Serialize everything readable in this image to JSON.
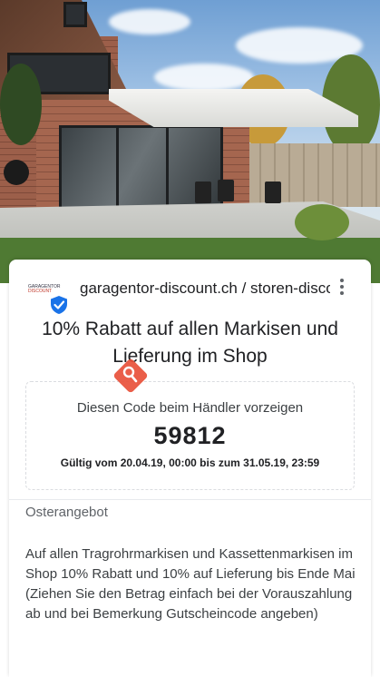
{
  "hero": {
    "image_label": "awning-house-photo"
  },
  "merchant": {
    "logo_line1": "GARAGENTOR",
    "logo_line2": "DISCOUNT",
    "name": "garagentor-discount.ch / storen-discount.ch"
  },
  "offer": {
    "title": "10% Rabatt auf allen Markisen und Lieferung im Shop",
    "instruction": "Diesen Code beim Händler vorzeigen",
    "code": "59812",
    "validity": "Gültig vom 20.04.19, 00:00 bis zum 31.05.19, 23:59",
    "label": "Osterangebot",
    "description": "Auf allen Tragrohrmarkisen und Kassettenmarkisen im Shop 10% Rabatt und 10% auf Lieferung bis Ende Mai (Ziehen Sie den Betrag einfach bei der Vorauszahlung ab und bei Bemerkung Gutscheincode angeben)"
  },
  "colors": {
    "verified_badge": "#1a73e8",
    "pin_marker": "#e8503a"
  }
}
